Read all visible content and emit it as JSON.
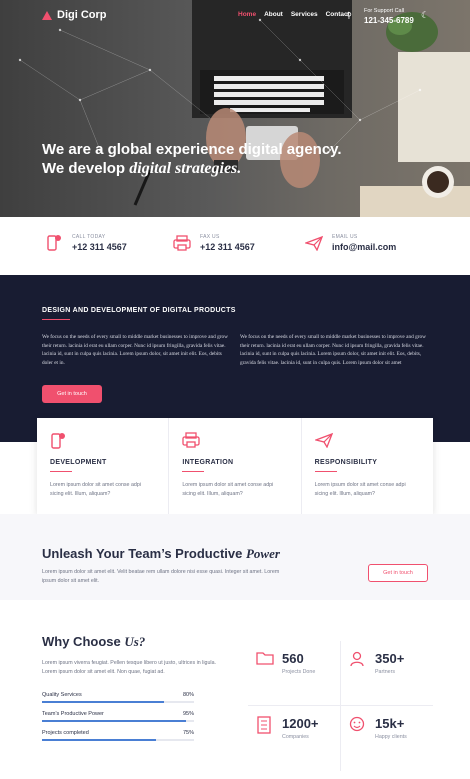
{
  "nav": {
    "brand": "Digi Corp",
    "menu": [
      "Home",
      "About",
      "Services",
      "Contact"
    ],
    "active_index": 0,
    "support_label": "For Support Call",
    "support_phone": "121-345-6789"
  },
  "hero": {
    "line1": "We are a global experience digital agency.",
    "line2_prefix": "We develop",
    "line2_emphasis": "digital strategies."
  },
  "contact": [
    {
      "icon": "phone-icon",
      "label": "CALL TODAY",
      "value": "+12 311 4567"
    },
    {
      "icon": "fax-icon",
      "label": "FAX US",
      "value": "+12 311 4567"
    },
    {
      "icon": "send-icon",
      "label": "EMAIL US",
      "value": "info@mail.com"
    }
  ],
  "about": {
    "title": "DESIGN AND DEVELOPMENT OF DIGITAL PRODUCTS",
    "para_left": "We focus on the needs of every small to middle market businesses to improve and grow their return. lacinia id erat eu ullam corper. Nunc id ipsum fringilla, gravida felis vitae. lacinia id, sunt in culpa quis lacinia. Lorem ipsum dolor, sit amet init elit. Eos, debits doler et in.",
    "para_right": "We focus on the needs of every small to middle market businesses to improve and grow their return. lacinia id erat eu ullam corper. Nunc id ipsum fringilla, gravida felis vitae. lacinia id, sunt in culpa quis lacinia. Lorem ipsum dolor, sit amet init elit. Eos, debits, gravida felis vitae. lacinia id, sunt in culpa quis. Lorem ipsum dolor sit amet",
    "button": "Get in touch"
  },
  "features": [
    {
      "icon": "phone-icon",
      "title": "DEVELOPMENT",
      "desc": "Lorem ipsum dolor sit amet conse adpi sicing elit. Illum, aliquam?"
    },
    {
      "icon": "fax-icon",
      "title": "INTEGRATION",
      "desc": "Lorem ipsum dolor sit amet conse adpi sicing elit. Illum, aliquam?"
    },
    {
      "icon": "send-icon",
      "title": "RESPONSIBILITY",
      "desc": "Lorem ipsum dolor sit amet conse adpi sicing elit. Illum, aliquam?"
    }
  ],
  "unleash": {
    "title_prefix": "Unleash Your Team’s Productive",
    "title_emphasis": "Power",
    "desc": "Lorem ipsum dolor sit amet elit. Velit beatae rem ullam dolore nisi esse quasi. Integer sit amet. Lorem ipsum dolor sit amet elit.",
    "button": "Get in touch"
  },
  "why": {
    "title_prefix": "Why Choose",
    "title_emphasis": "Us?",
    "desc": "Lorem ipsum viverra feugiat. Pellen tesque libero ut justo, ultrices in ligula. Lorem ipsum dolor sit amet elit. Non quae, fugiat ad.",
    "bars": [
      {
        "label": "Quality Services",
        "percent": 80,
        "percent_text": "80%"
      },
      {
        "label": "Team's Productive Power",
        "percent": 95,
        "percent_text": "95%"
      },
      {
        "label": "Projects completed",
        "percent": 75,
        "percent_text": "75%"
      }
    ],
    "stats": [
      {
        "icon": "folder-icon",
        "number": "560",
        "label": "Projects Done"
      },
      {
        "icon": "user-icon",
        "number": "350+",
        "label": "Partners"
      },
      {
        "icon": "building-icon",
        "number": "1200+",
        "label": "Companies"
      },
      {
        "icon": "smile-icon",
        "number": "15k+",
        "label": "Happy clients"
      }
    ]
  },
  "colors": {
    "accent": "#f0506e",
    "dark": "#181c32",
    "bar": "#4a7fd4"
  }
}
